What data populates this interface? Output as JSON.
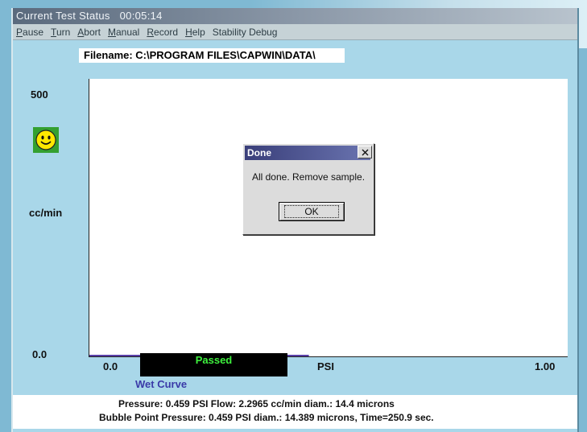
{
  "window": {
    "title": "Current Test Status",
    "timer": "00:05:14"
  },
  "menu": {
    "items": [
      {
        "accel": "P",
        "rest": "ause"
      },
      {
        "accel": "T",
        "rest": "urn"
      },
      {
        "accel": "A",
        "rest": "bort"
      },
      {
        "accel": "M",
        "rest": "anual"
      },
      {
        "accel": "R",
        "rest": "ecord"
      },
      {
        "accel": "H",
        "rest": "elp"
      },
      {
        "accel": "",
        "rest": "Stability Debug"
      }
    ]
  },
  "filename": "Filename:  C:\\PROGRAM FILES\\CAPWIN\\DATA\\",
  "chart_data": {
    "type": "line",
    "title": "",
    "xlabel": "PSI",
    "ylabel": "cc/min",
    "xlim": [
      0.0,
      1.0
    ],
    "ylim": [
      0.0,
      500
    ],
    "x_tick_labels": [
      "0.0",
      "1.00"
    ],
    "y_tick_labels": [
      "0.0",
      "500"
    ],
    "series": [
      {
        "name": "Wet Curve",
        "color": "#5a3fa8",
        "x": [
          0.0,
          0.459
        ],
        "y": [
          0.0,
          0.0
        ]
      }
    ]
  },
  "status": {
    "label": "Passed",
    "color": "#3ef03e",
    "indicator_icon": "smiley-icon"
  },
  "legend": {
    "wet_curve": "Wet Curve"
  },
  "footer": {
    "line1": "Pressure:   0.459  PSI   Flow:   2.2965 cc/min   diam.:  14.4 microns",
    "line2": "Bubble Point Pressure: 0.459  PSI   diam.: 14.389 microns, Time=250.9 sec."
  },
  "dialog": {
    "title": "Done",
    "message": "All done. Remove sample.",
    "ok_label": "OK"
  }
}
